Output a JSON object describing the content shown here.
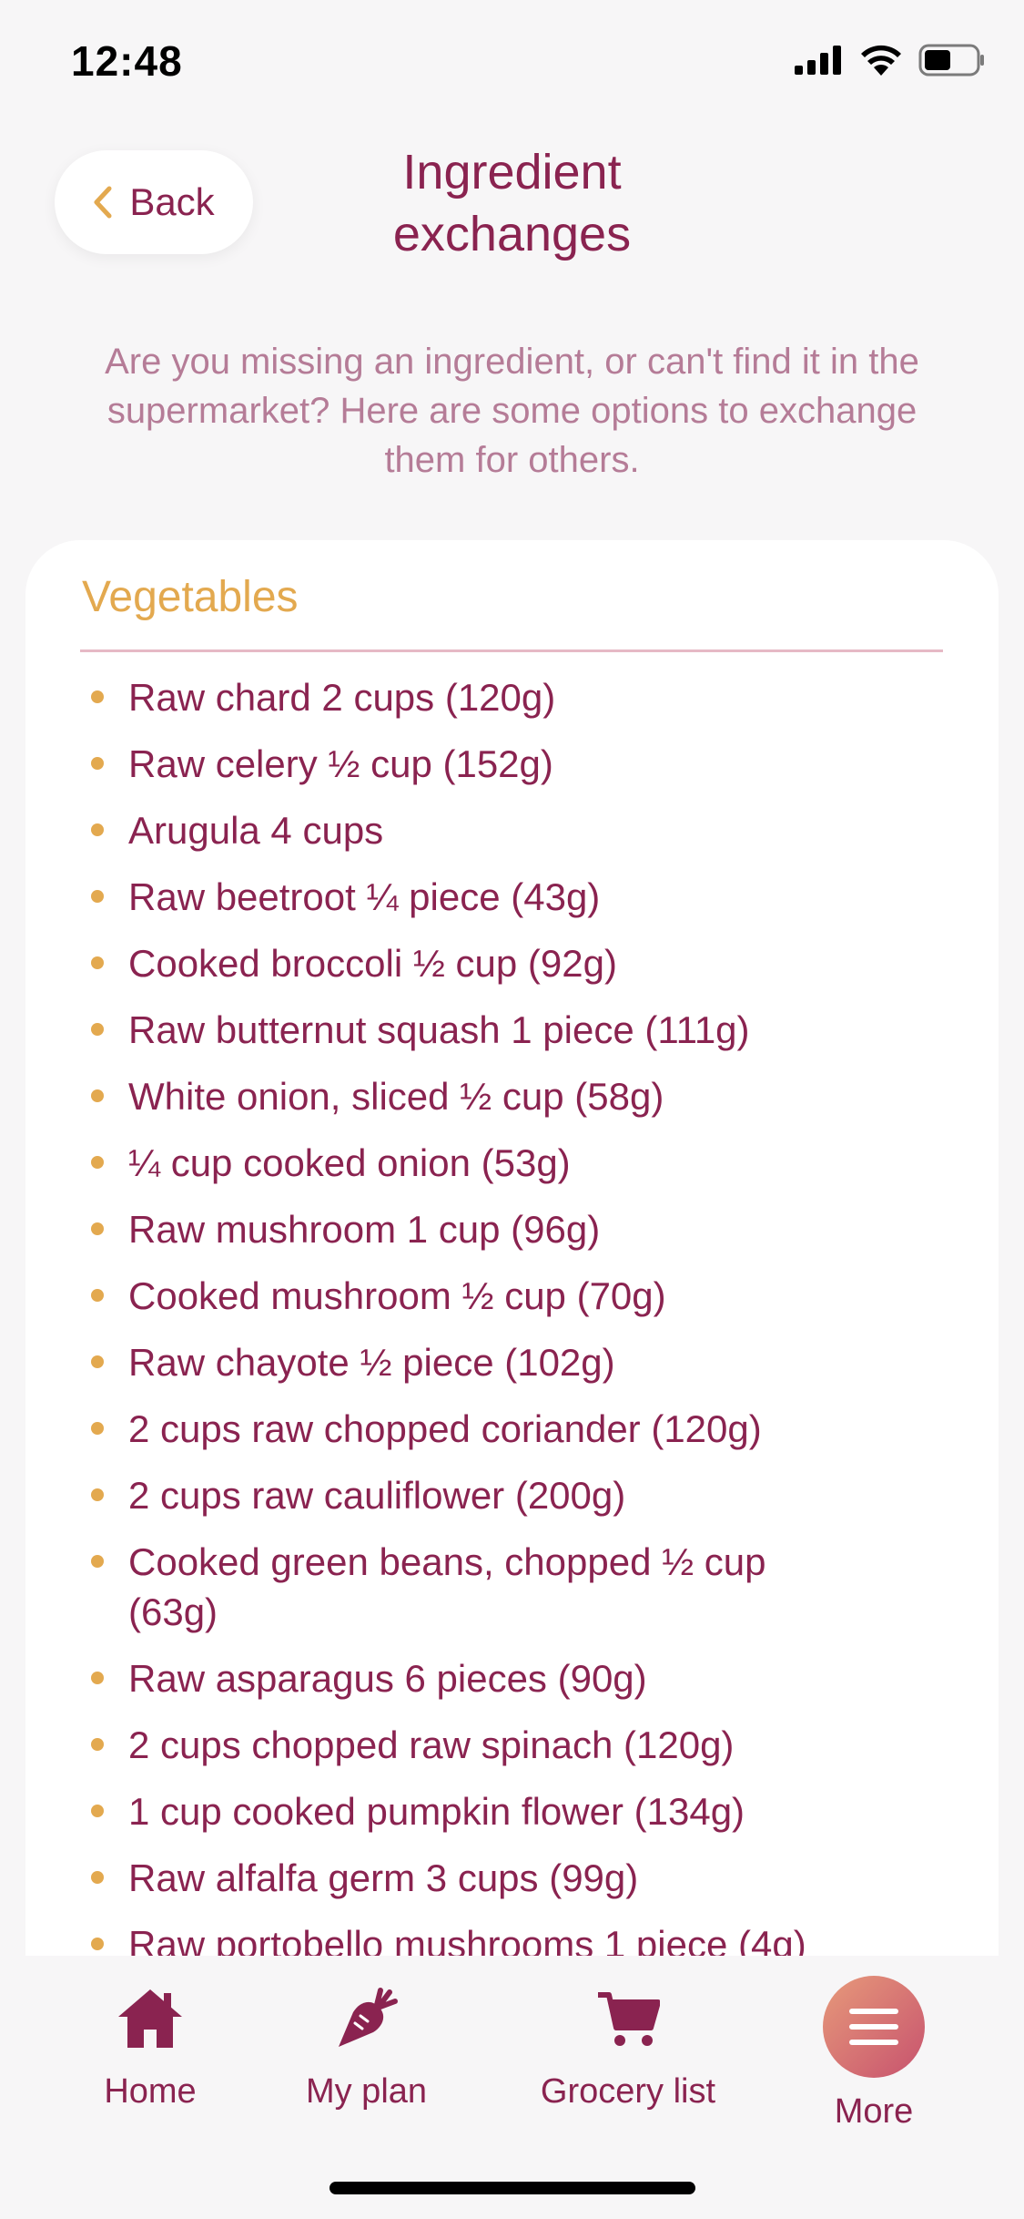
{
  "status": {
    "time": "12:48"
  },
  "header": {
    "back_label": "Back",
    "title": "Ingredient exchanges"
  },
  "intro": "Are you missing an ingredient, or can't find it in the supermarket? Here are some options to exchange them for others.",
  "section": {
    "title": "Vegetables",
    "items": [
      "Raw chard 2 cups (120g)",
      "Raw celery ½ cup (152g)",
      "Arugula 4 cups",
      "Raw beetroot ¼ piece (43g)",
      "Cooked broccoli ½ cup (92g)",
      "Raw butternut squash 1 piece (111g)",
      "White onion, sliced ½ cup (58g)",
      "¼ cup cooked onion (53g)",
      "Raw mushroom 1 cup (96g)",
      "Cooked mushroom ½ cup (70g)",
      "Raw chayote ½ piece (102g)",
      "2 cups raw chopped coriander (120g)",
      "2 cups raw cauliflower (200g)",
      "Cooked green beans, chopped ½ cup (63g)",
      "Raw asparagus 6 pieces (90g)",
      "2 cups chopped raw spinach (120g)",
      "1 cup cooked pumpkin flower (134g)",
      "Raw alfalfa germ 3 cups (99g)",
      "Raw portobello mushrooms 1 piece (4g)"
    ]
  },
  "tabs": [
    {
      "label": "Home",
      "icon": "home-icon"
    },
    {
      "label": "My plan",
      "icon": "carrot-icon"
    },
    {
      "label": "Grocery list",
      "icon": "cart-icon"
    },
    {
      "label": "More",
      "icon": "menu-icon"
    }
  ],
  "colors": {
    "primary": "#8a2350",
    "accent": "#e3a94f",
    "muted": "#b57c97"
  }
}
